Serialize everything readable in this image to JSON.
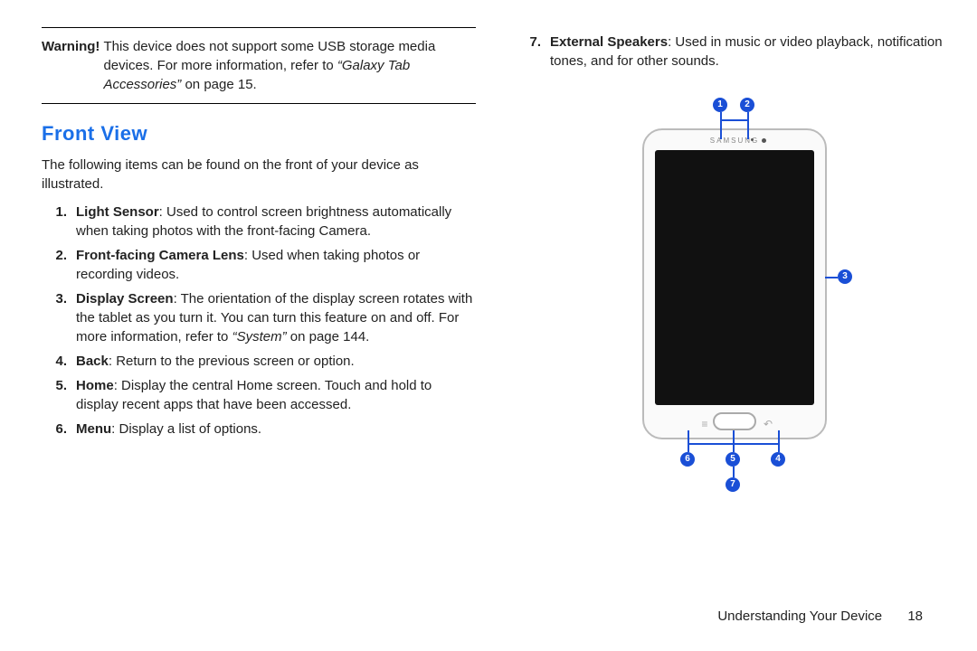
{
  "warning": {
    "label": "Warning!",
    "text": "This device does not support some USB storage media devices. For more information, refer to ",
    "xref": "“Galaxy Tab Accessories”",
    "xref_suffix": " on page 15."
  },
  "section_title": "Front View",
  "intro": "The following items can be found on the front of your device as illustrated.",
  "features": [
    {
      "n": "1.",
      "name": "Light Sensor",
      "text": ": Used to control screen brightness automatically when taking photos with the front-facing Camera."
    },
    {
      "n": "2.",
      "name": "Front-facing Camera Lens",
      "text": ": Used when taking photos or recording videos."
    },
    {
      "n": "3.",
      "name": "Display Screen",
      "text": ": The orientation of the display screen rotates with the tablet as you turn it. You can turn this feature on and off. For more information, refer to ",
      "xref": "“System”",
      "xref_suffix": " on page 144."
    },
    {
      "n": "4.",
      "name": "Back",
      "text": ": Return to the previous screen or option."
    },
    {
      "n": "5.",
      "name": "Home",
      "text": ": Display the central Home screen. Touch and hold to display recent apps that have been accessed."
    },
    {
      "n": "6.",
      "name": "Menu",
      "text": ": Display a list of options."
    },
    {
      "n": "7.",
      "name": "External Speakers",
      "text": ": Used in music or video playback, notification tones, and for other sounds."
    }
  ],
  "diagram": {
    "brand": "SAMSUNG",
    "callouts": [
      "1",
      "2",
      "3",
      "4",
      "5",
      "6",
      "7"
    ]
  },
  "footer": {
    "chapter": "Understanding Your Device",
    "page": "18"
  }
}
